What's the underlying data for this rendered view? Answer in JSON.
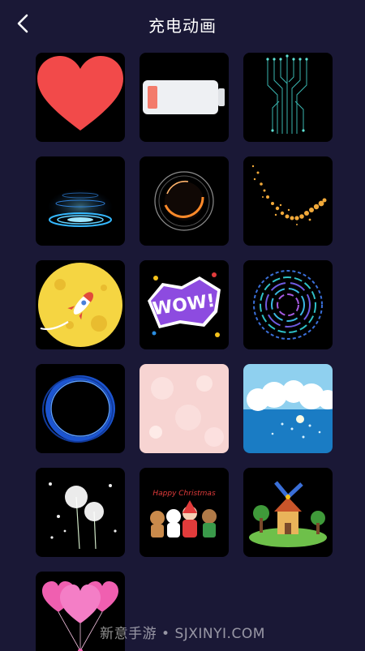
{
  "header": {
    "title": "充电动画",
    "back_icon": "chevron-left-icon"
  },
  "animations": [
    {
      "name": "heart"
    },
    {
      "name": "battery"
    },
    {
      "name": "circuit"
    },
    {
      "name": "hologram-portal"
    },
    {
      "name": "eclipse-ring"
    },
    {
      "name": "golden-sparkle-trail"
    },
    {
      "name": "moon-rocket"
    },
    {
      "name": "wow-sticker"
    },
    {
      "name": "circular-spectrum"
    },
    {
      "name": "blue-vortex-ring"
    },
    {
      "name": "pink-bokeh"
    },
    {
      "name": "ocean-clouds"
    },
    {
      "name": "dandelions"
    },
    {
      "name": "christmas-characters"
    },
    {
      "name": "windmill-village"
    },
    {
      "name": "pink-heart-balloons"
    }
  ],
  "sticker_text": "WOW!",
  "christmas_text": "Happy Christmas",
  "watermark": "新意手游 • SJXINYI.COM"
}
